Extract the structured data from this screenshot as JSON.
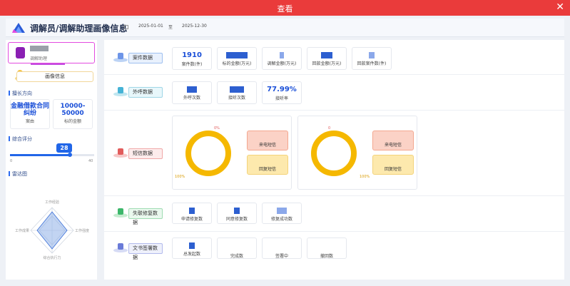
{
  "window": {
    "title": "查看",
    "close_icon": "close-icon"
  },
  "header": {
    "title": "调解员/调解助理画像信息",
    "date_start": "2025-01-01",
    "date_sep": "至",
    "date_end": "2025-12-30"
  },
  "sidebar": {
    "user_role": "调解助理",
    "profile_button": "画像信息",
    "expertise_title": "擅长方向",
    "expertise": [
      {
        "value": "金融借款合同纠纷",
        "label": "案由"
      },
      {
        "value": "10000-50000",
        "label": "标的金额"
      }
    ],
    "score_title": "综合评分",
    "score": {
      "value": "28",
      "min": "0",
      "max": "40",
      "fraction": 0.7
    },
    "radar_title": "雷达图",
    "radar_axes": [
      "工作经验",
      "工作强度",
      "综合执行力",
      "工作成果"
    ]
  },
  "sections": {
    "case": {
      "label": "案件数据",
      "stats": [
        {
          "value": "1910",
          "label": "案件数(件)"
        },
        {
          "value": "",
          "label": "标的金额(万元)"
        },
        {
          "value": "",
          "label": "调解金额(万元)"
        },
        {
          "value": "",
          "label": "回款金额(万元)"
        },
        {
          "value": "",
          "label": "回款案件数(件)"
        }
      ]
    },
    "outbound": {
      "label": "外呼数据",
      "stats": [
        {
          "value": "",
          "label": "外呼次数"
        },
        {
          "value": "",
          "label": "接听次数"
        },
        {
          "value": "77.99%",
          "label": "接听率"
        }
      ]
    },
    "sms": {
      "label": "短信数据",
      "donut_left": {
        "label_top": "0%",
        "label_bottom": "100%",
        "cards": [
          "来电短信",
          "回复短信"
        ]
      },
      "donut_right": {
        "label_top": "0",
        "label_bottom": "100%",
        "cards": [
          "来电短信",
          "回复短信"
        ]
      }
    },
    "repair": {
      "label": "失联修复数据",
      "stats": [
        {
          "label": "申请修复数"
        },
        {
          "label": "同意修复数"
        },
        {
          "label": "修复成功数"
        }
      ]
    },
    "doc": {
      "label": "文书签署数据",
      "stats": [
        {
          "label": "总发起数"
        },
        {
          "label": "完成数"
        },
        {
          "label": "签署中"
        },
        {
          "label": "撤回数"
        }
      ]
    }
  },
  "colors": {
    "accent": "#2166e8",
    "titlebar": "#ea3b3b",
    "donut": "#f5b800"
  }
}
